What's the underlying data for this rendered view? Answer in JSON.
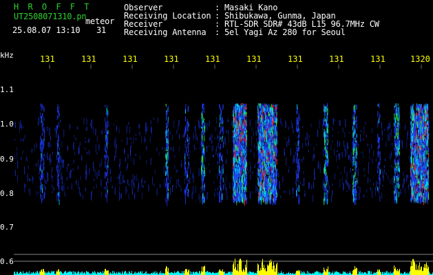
{
  "header": {
    "app_name": "H R O F F T",
    "file_name": "UT2508071310.pn",
    "meteor_label": "meteor",
    "timestamp": "25.08.07 13:10",
    "meteor_count": "31",
    "fields": [
      {
        "label": "Observer",
        "value": "Masaki Kano"
      },
      {
        "label": "Receiving Location",
        "value": "Shibukawa, Gunma, Japan"
      },
      {
        "label": "Receiver",
        "value": "RTL-SDR SDR# 43dB L15 96.7MHz CW"
      },
      {
        "label": "Receiving Antenna",
        "value": "5el Yagi Az 280 for Seoul"
      }
    ]
  },
  "y_axis": {
    "unit_label": "kHz",
    "ticks": [
      "1.1",
      "1.0",
      "0.9",
      "0.8",
      "0.7",
      "0.6"
    ]
  },
  "x_axis": {
    "tick_labels": [
      "131",
      "131",
      "131",
      "131",
      "131",
      "131",
      "131",
      "131",
      "131",
      "1320"
    ]
  },
  "colors": {
    "background": "#000000",
    "header_green": "#2fd12f",
    "header_white": "#ffffff",
    "x_tick_yellow": "#ffff00",
    "power_trace": "#ffff00",
    "noise_trace": "#00ffff",
    "signal_blue": "#1e3cff",
    "signal_cyan": "#00e5ff",
    "signal_green": "#33ff33",
    "signal_red": "#ff2020"
  }
}
